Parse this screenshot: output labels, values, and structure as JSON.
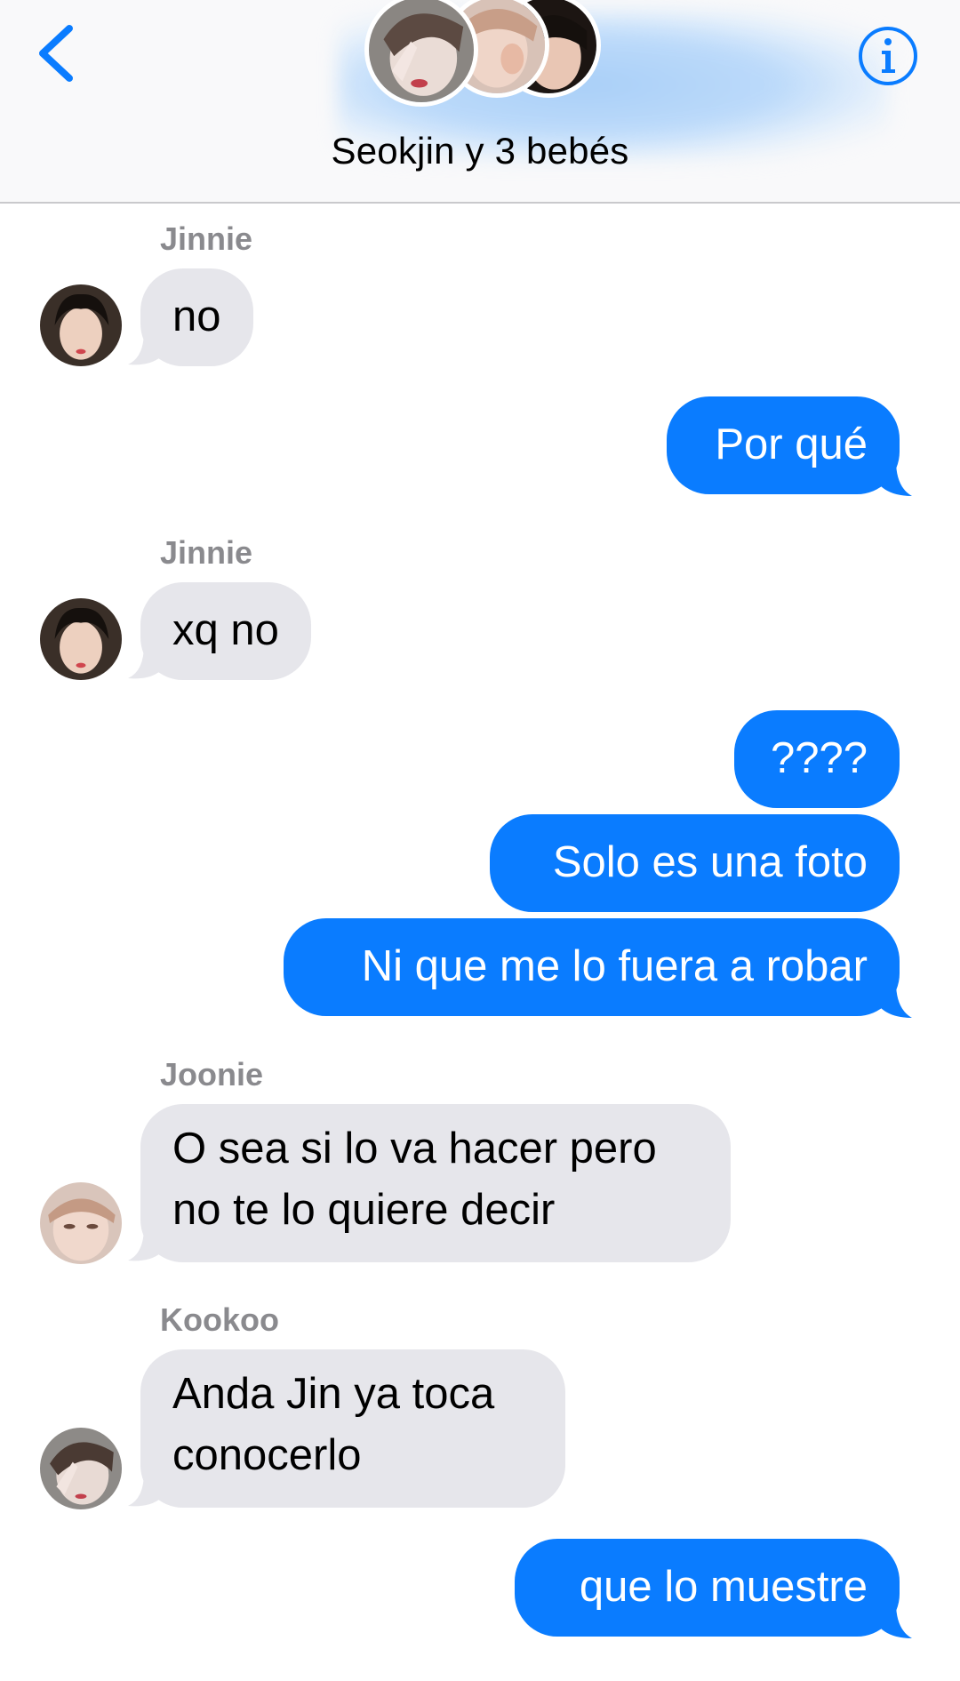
{
  "colors": {
    "accent": "#0a7cff",
    "incoming_bubble": "#e6e6eb",
    "sender_name": "#8a8a8e"
  },
  "header": {
    "title": "Seokjin y 3 bebés",
    "back_icon": "chevron-left-icon",
    "info_icon": "info-circle-icon"
  },
  "messages": [
    {
      "sender": "Jinnie",
      "direction": "in",
      "lines": [
        "no"
      ]
    },
    {
      "direction": "out",
      "lines": [
        "Por qué"
      ]
    },
    {
      "sender": "Jinnie",
      "direction": "in",
      "lines": [
        "xq no"
      ]
    },
    {
      "direction": "out",
      "lines": [
        "????"
      ]
    },
    {
      "direction": "out",
      "lines": [
        "Solo es una foto"
      ]
    },
    {
      "direction": "out",
      "lines": [
        "Ni que me lo fuera a robar"
      ]
    },
    {
      "sender": "Joonie",
      "direction": "in",
      "lines": [
        "O sea si lo va hacer pero",
        "no te lo quiere decir"
      ]
    },
    {
      "sender": "Kookoo",
      "direction": "in",
      "lines": [
        "Anda Jin ya toca",
        "conocerlo"
      ]
    },
    {
      "direction": "out",
      "lines": [
        "que lo muestre"
      ]
    }
  ]
}
